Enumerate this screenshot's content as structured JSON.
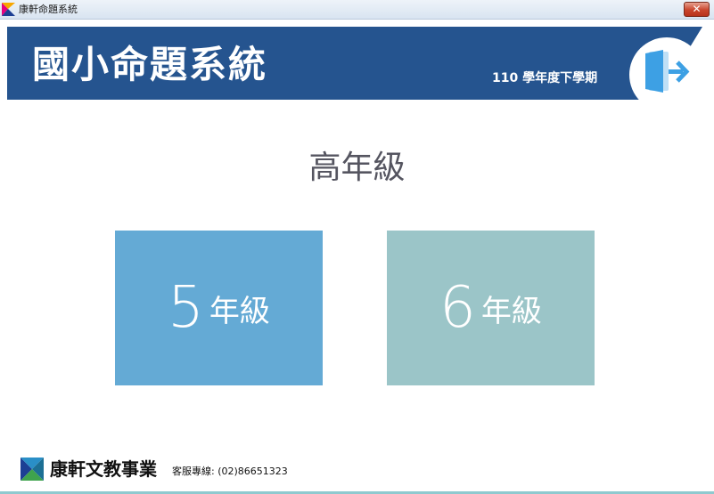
{
  "window": {
    "title": "康軒命題系統",
    "close_label": "✕"
  },
  "header": {
    "title": "國小命題系統",
    "term": "110 學年度下學期",
    "exit_icon": "exit-door-icon"
  },
  "main": {
    "section_title": "高年級",
    "grades": [
      {
        "number": "5",
        "unit": "年級",
        "color": "#64aad5"
      },
      {
        "number": "6",
        "unit": "年級",
        "color": "#9bc5c8"
      }
    ]
  },
  "footer": {
    "company": "康軒文教事業",
    "service": "客服專線: (02)86651323"
  },
  "colors": {
    "banner": "#25548f",
    "exit_icon": "#3da0e4",
    "bottom_line": "#8fc9cf"
  }
}
